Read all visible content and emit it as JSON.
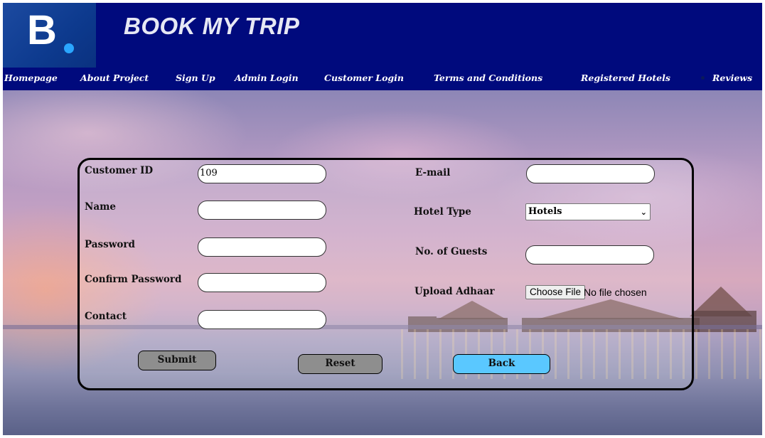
{
  "brand": {
    "logo_letter": "B",
    "title": "BOOK MY TRIP",
    "colors": {
      "header_bg": "#000a7d",
      "logo_dot": "#2aa6ff"
    }
  },
  "nav": {
    "items": [
      {
        "label": "Homepage"
      },
      {
        "label": "About Project"
      },
      {
        "label": "Sign Up"
      },
      {
        "label": "Admin Login"
      },
      {
        "label": "Customer Login"
      },
      {
        "label": "Terms and Conditions"
      },
      {
        "label": "Registered Hotels"
      },
      {
        "label": "Reviews"
      }
    ]
  },
  "form": {
    "customer_id": {
      "label": "Customer ID",
      "value": "109"
    },
    "name": {
      "label": "Name",
      "value": ""
    },
    "password": {
      "label": "Password",
      "value": ""
    },
    "confirm_password": {
      "label": "Confirm Password",
      "value": ""
    },
    "contact": {
      "label": "Contact",
      "value": ""
    },
    "email": {
      "label": "E-mail",
      "value": ""
    },
    "hotel_type": {
      "label": "Hotel Type",
      "selected": "Hotels"
    },
    "guests": {
      "label": "No. of Guests",
      "value": ""
    },
    "adhaar": {
      "label": "Upload Adhaar",
      "button": "Choose File",
      "status": "No file chosen"
    }
  },
  "buttons": {
    "submit": "Submit",
    "reset": "Reset",
    "back": "Back",
    "colors": {
      "submit": "#8e8e8e",
      "reset": "#8e8e8e",
      "back": "#5ac8ff"
    }
  }
}
